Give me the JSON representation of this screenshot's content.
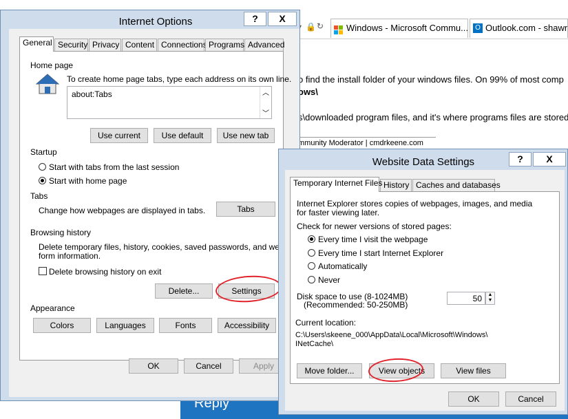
{
  "browser": {
    "tabs": [
      {
        "label": "Windows - Microsoft Commu..."
      },
      {
        "label": "Outlook.com - shawn.t"
      }
    ],
    "content_lines": [
      "o find the install folder of your windows files.  On 99% of most comp",
      "ows\\",
      "s\\downloaded program files, and it's where programs files are stored",
      "mmunity Moderator | cmdrkeene.com"
    ],
    "reply_label": "Reply"
  },
  "internet_options": {
    "title": "Internet Options",
    "help_btn": "?",
    "close_btn": "X",
    "tabs": [
      "General",
      "Security",
      "Privacy",
      "Content",
      "Connections",
      "Programs",
      "Advanced"
    ],
    "home_page": {
      "heading": "Home page",
      "hint": "To create home page tabs, type each address on its own line.",
      "value": "about:Tabs",
      "use_current": "Use current",
      "use_default": "Use default",
      "use_new_tab": "Use new tab"
    },
    "startup": {
      "heading": "Startup",
      "option_1": "Start with tabs from the last session",
      "option_2": "Start with home page",
      "selected": 2
    },
    "tabs_section": {
      "heading": "Tabs",
      "text": "Change how webpages are displayed in tabs.",
      "button": "Tabs"
    },
    "browsing_history": {
      "heading": "Browsing history",
      "text_1": "Delete temporary files, history, cookies, saved passwords, and web",
      "text_2": "form information.",
      "checkbox_label": "Delete browsing history on exit",
      "checked": false,
      "delete_btn": "Delete...",
      "settings_btn": "Settings"
    },
    "appearance": {
      "heading": "Appearance",
      "colors": "Colors",
      "languages": "Languages",
      "fonts": "Fonts",
      "accessibility": "Accessibility"
    },
    "ok": "OK",
    "cancel": "Cancel",
    "apply": "Apply"
  },
  "website_data": {
    "title": "Website Data Settings",
    "help_btn": "?",
    "close_btn": "X",
    "tabs": [
      "Temporary Internet Files",
      "History",
      "Caches and databases"
    ],
    "intro_1": "Internet Explorer stores copies of webpages, images, and media",
    "intro_2": "for faster viewing later.",
    "check_heading": "Check for newer versions of stored pages:",
    "options": [
      "Every time I visit the webpage",
      "Every time I start Internet Explorer",
      "Automatically",
      "Never"
    ],
    "selected_option": 0,
    "disk_label_1": "Disk space to use (8-1024MB)",
    "disk_label_2": "(Recommended: 50-250MB)",
    "disk_value": "50",
    "location_label": "Current location:",
    "location_1": "C:\\Users\\skeene_000\\AppData\\Local\\Microsoft\\Windows\\",
    "location_2": "INetCache\\",
    "move_folder": "Move folder...",
    "view_objects": "View objects",
    "view_files": "View files",
    "ok": "OK",
    "cancel": "Cancel"
  },
  "colors": {
    "reply_bar": "#1f74c1",
    "annotation": "#e0232a"
  }
}
